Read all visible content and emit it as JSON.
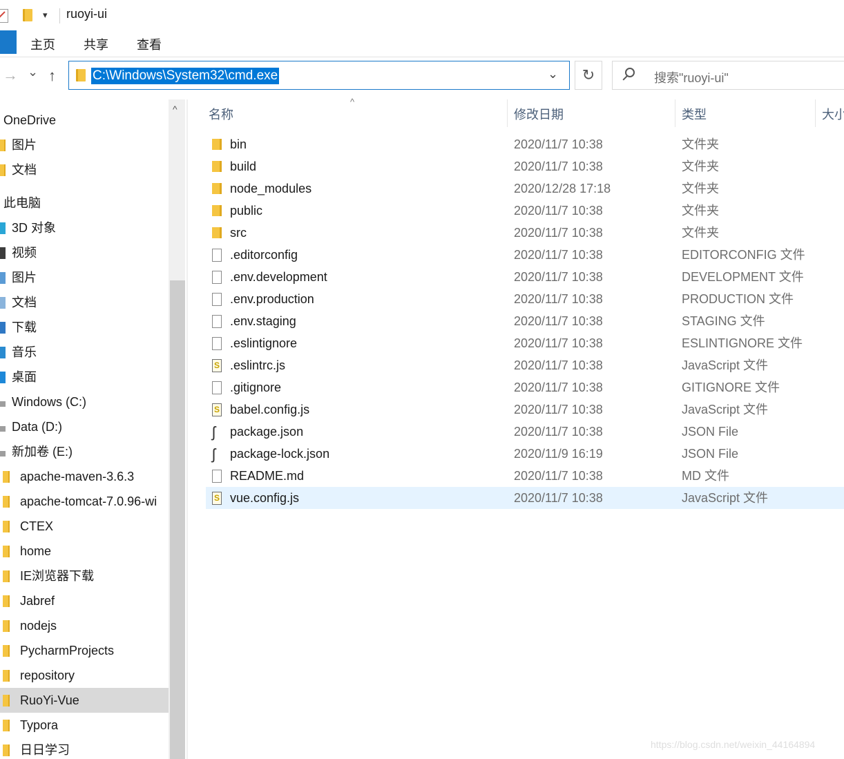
{
  "window": {
    "title": "ruoyi-ui",
    "qa_dropdown": "▾"
  },
  "ribbon": {
    "tabs": [
      "主页",
      "共享",
      "查看"
    ]
  },
  "nav": {
    "back": "→",
    "recent": "⌄",
    "up": "↑",
    "address": "C:\\Windows\\System32\\cmd.exe",
    "address_dropdown": "⌄",
    "refresh": "↻",
    "search_placeholder": "搜索\"ruoyi-ui\""
  },
  "sidebar": {
    "scroll_up": "^",
    "items": [
      {
        "label": "OneDrive",
        "icon": "onedrive-icon"
      },
      {
        "label": "图片",
        "icon": "folder-icon"
      },
      {
        "label": "文档",
        "icon": "folder-icon"
      },
      {
        "label": "此电脑",
        "icon": "pc-icon"
      },
      {
        "label": "3D 对象",
        "icon": "cube-icon"
      },
      {
        "label": "视频",
        "icon": "video-icon"
      },
      {
        "label": "图片",
        "icon": "pictures-icon"
      },
      {
        "label": "文档",
        "icon": "documents-icon"
      },
      {
        "label": "下载",
        "icon": "download-icon"
      },
      {
        "label": "音乐",
        "icon": "music-icon"
      },
      {
        "label": "桌面",
        "icon": "desktop-icon"
      },
      {
        "label": "Windows (C:)",
        "icon": "drive-icon"
      },
      {
        "label": "Data (D:)",
        "icon": "drive-icon"
      },
      {
        "label": "新加卷 (E:)",
        "icon": "drive-icon"
      },
      {
        "label": "apache-maven-3.6.3",
        "icon": "folder-icon"
      },
      {
        "label": "apache-tomcat-7.0.96-wi",
        "icon": "folder-icon"
      },
      {
        "label": "CTEX",
        "icon": "folder-icon"
      },
      {
        "label": "home",
        "icon": "folder-icon"
      },
      {
        "label": "IE浏览器下载",
        "icon": "folder-icon"
      },
      {
        "label": "Jabref",
        "icon": "folder-icon"
      },
      {
        "label": "nodejs",
        "icon": "folder-icon"
      },
      {
        "label": "PycharmProjects",
        "icon": "folder-icon"
      },
      {
        "label": "repository",
        "icon": "folder-icon"
      },
      {
        "label": "RuoYi-Vue",
        "icon": "folder-icon",
        "selected": true
      },
      {
        "label": "Typora",
        "icon": "folder-icon"
      },
      {
        "label": "日日学习",
        "icon": "folder-icon"
      }
    ]
  },
  "columns": {
    "name": "名称",
    "date": "修改日期",
    "type": "类型",
    "size": "大小",
    "sort_arrow": "^"
  },
  "files": [
    {
      "name": "bin",
      "date": "2020/11/7 10:38",
      "type": "文件夹",
      "icon": "folder-icon"
    },
    {
      "name": "build",
      "date": "2020/11/7 10:38",
      "type": "文件夹",
      "icon": "folder-icon"
    },
    {
      "name": "node_modules",
      "date": "2020/12/28 17:18",
      "type": "文件夹",
      "icon": "folder-icon"
    },
    {
      "name": "public",
      "date": "2020/11/7 10:38",
      "type": "文件夹",
      "icon": "folder-icon"
    },
    {
      "name": "src",
      "date": "2020/11/7 10:38",
      "type": "文件夹",
      "icon": "folder-icon"
    },
    {
      "name": ".editorconfig",
      "date": "2020/11/7 10:38",
      "type": "EDITORCONFIG 文件",
      "icon": "file-icon"
    },
    {
      "name": ".env.development",
      "date": "2020/11/7 10:38",
      "type": "DEVELOPMENT 文件",
      "icon": "file-icon"
    },
    {
      "name": ".env.production",
      "date": "2020/11/7 10:38",
      "type": "PRODUCTION 文件",
      "icon": "file-icon"
    },
    {
      "name": ".env.staging",
      "date": "2020/11/7 10:38",
      "type": "STAGING 文件",
      "icon": "file-icon"
    },
    {
      "name": ".eslintignore",
      "date": "2020/11/7 10:38",
      "type": "ESLINTIGNORE 文件",
      "icon": "file-icon"
    },
    {
      "name": ".eslintrc.js",
      "date": "2020/11/7 10:38",
      "type": "JavaScript 文件",
      "icon": "js-file-icon"
    },
    {
      "name": ".gitignore",
      "date": "2020/11/7 10:38",
      "type": "GITIGNORE 文件",
      "icon": "file-icon"
    },
    {
      "name": "babel.config.js",
      "date": "2020/11/7 10:38",
      "type": "JavaScript 文件",
      "icon": "js-file-icon"
    },
    {
      "name": "package.json",
      "date": "2020/11/7 10:38",
      "type": "JSON File",
      "icon": "json-file-icon"
    },
    {
      "name": "package-lock.json",
      "date": "2020/11/9 16:19",
      "type": "JSON File",
      "icon": "json-file-icon"
    },
    {
      "name": "README.md",
      "date": "2020/11/7 10:38",
      "type": "MD 文件",
      "icon": "file-icon"
    },
    {
      "name": "vue.config.js",
      "date": "2020/11/7 10:38",
      "type": "JavaScript 文件",
      "icon": "js-file-icon",
      "selected": true
    }
  ],
  "watermark": "https://blog.csdn.net/weixin_44164894"
}
